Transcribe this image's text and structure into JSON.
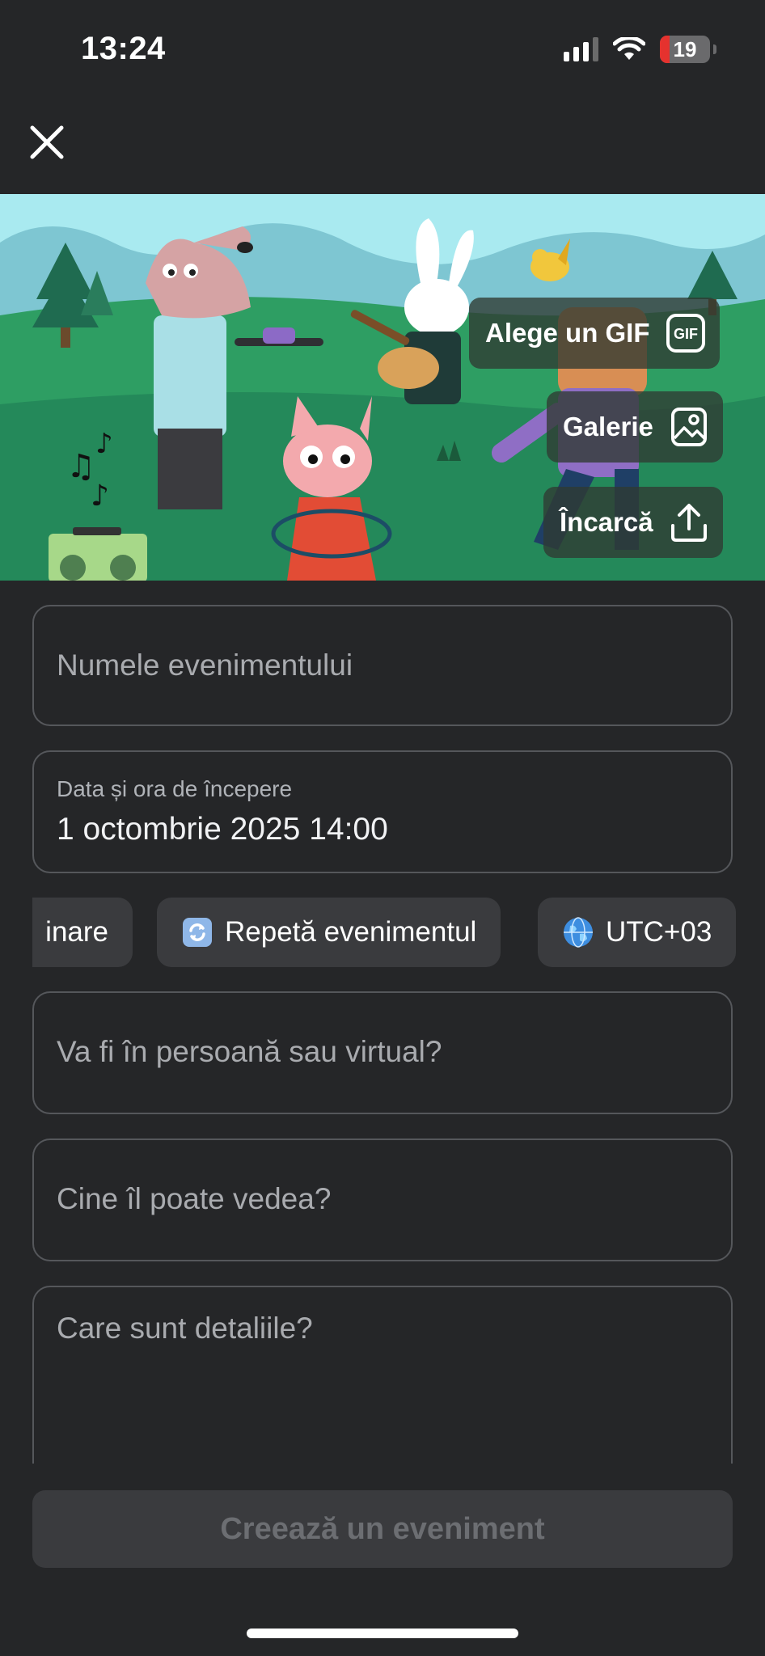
{
  "status_bar": {
    "time": "13:24",
    "battery_level": "19",
    "battery_percent": 19,
    "signal_bars": 3,
    "icons": [
      "signal-icon",
      "wifi-icon",
      "battery-icon"
    ]
  },
  "header": {
    "close_icon": "close-icon"
  },
  "banner": {
    "gif_label": "Alege un GIF",
    "gallery_label": "Galerie",
    "upload_label": "Încarcă",
    "icons": [
      "gif-icon",
      "gallery-icon",
      "upload-icon"
    ]
  },
  "form": {
    "event_name_placeholder": "Numele evenimentului",
    "start_label": "Data și ora de începere",
    "start_value": "1 octombrie 2025 14:00",
    "location_placeholder": "Va fi în persoană sau virtual?",
    "visibility_placeholder": "Cine îl poate vedea?",
    "details_placeholder": "Care sunt detaliile?"
  },
  "chips": {
    "end_partial": "inare",
    "repeat": "Repetă evenimentul",
    "timezone": "UTC+03",
    "icons": [
      "repeat-icon",
      "globe-icon"
    ]
  },
  "footer": {
    "create_button": "Creează un eveniment"
  },
  "colors": {
    "background": "#252628",
    "field_border": "#55575b",
    "chip_bg": "#3a3b3e",
    "disabled_text": "#6c6e72",
    "battery_low": "#e5322e"
  }
}
